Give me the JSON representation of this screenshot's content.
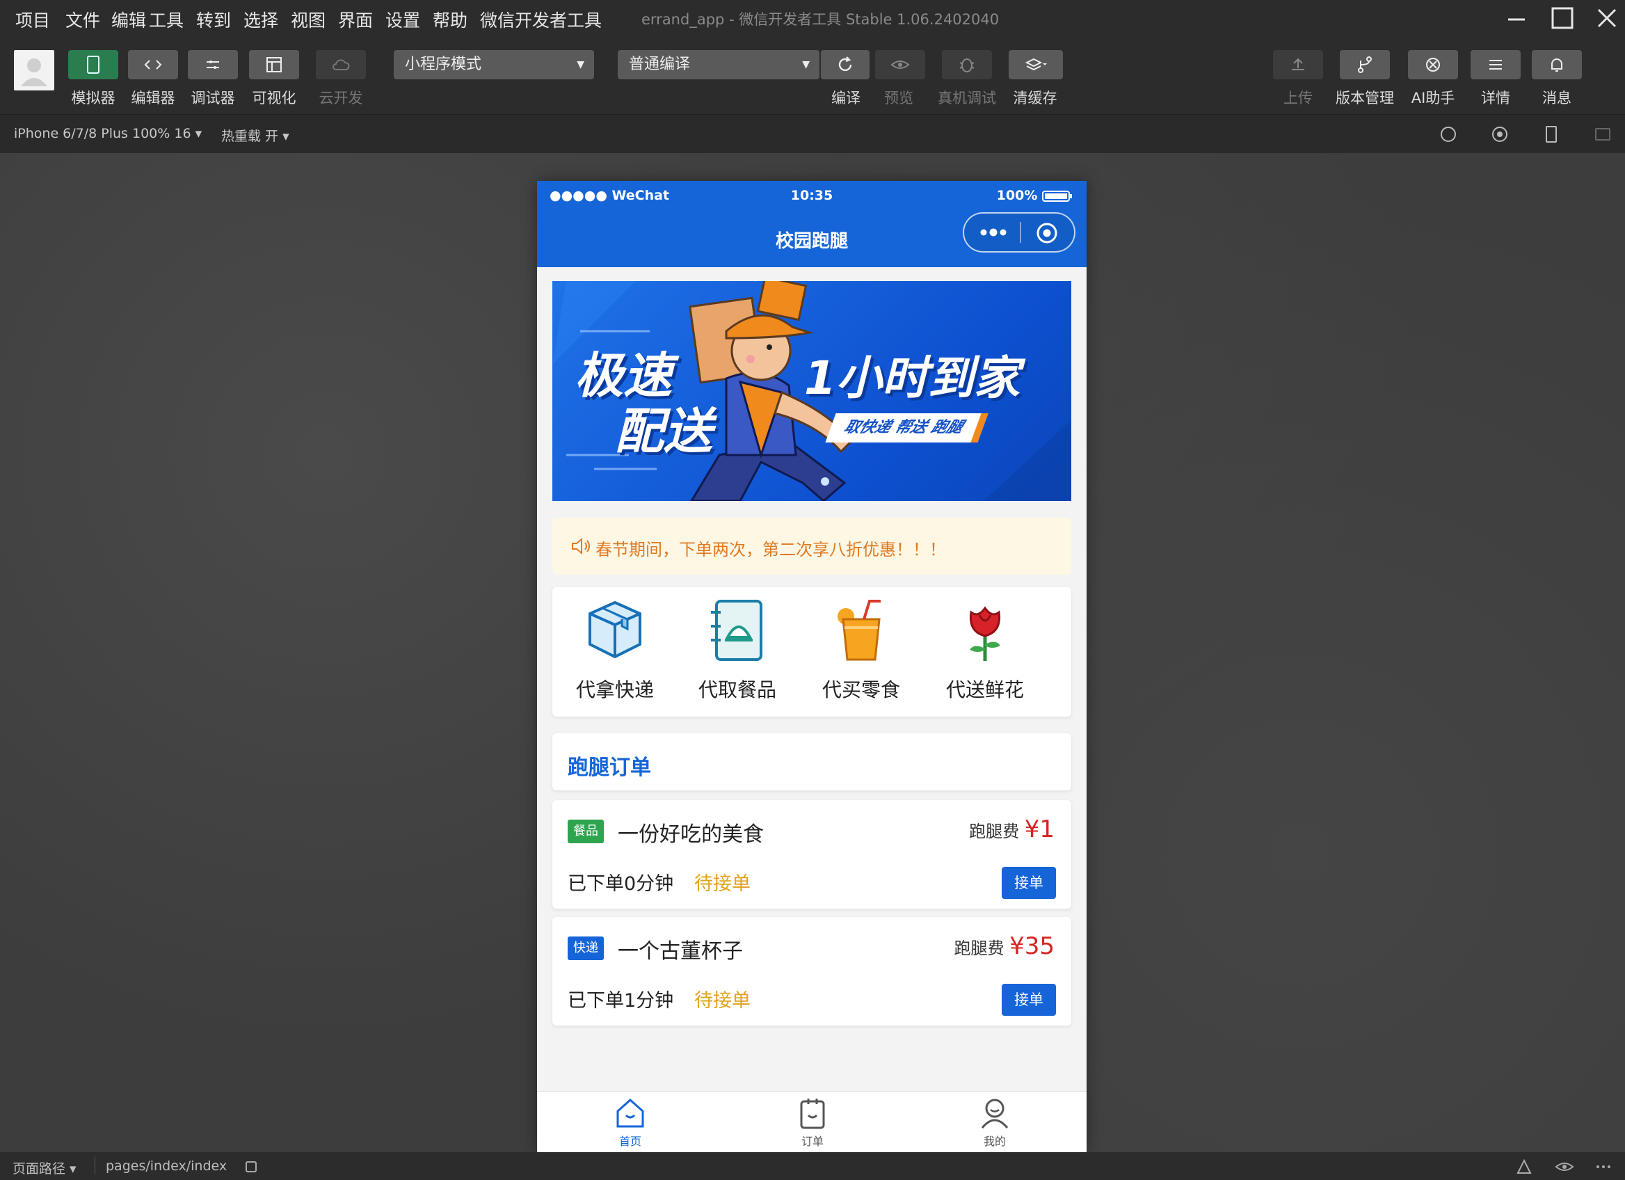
{
  "menubar": {
    "items": [
      "项目",
      "文件",
      "编辑",
      "工具",
      "转到",
      "选择",
      "视图",
      "界面",
      "设置",
      "帮助",
      "微信开发者工具"
    ],
    "window_title": "errand_app - 微信开发者工具 Stable 1.06.2402040"
  },
  "toolbar": {
    "buttons": [
      {
        "label": "模拟器",
        "icon": "phone-icon",
        "active": true
      },
      {
        "label": "编辑器",
        "icon": "code-icon",
        "active": false
      },
      {
        "label": "调试器",
        "icon": "debug-icon",
        "active": false
      },
      {
        "label": "可视化",
        "icon": "layout-icon",
        "active": false
      },
      {
        "label": "云开发",
        "icon": "cloud-icon",
        "active": false
      }
    ],
    "mode_select": "小程序模式",
    "compile_select": "普通编译",
    "compile_actions": [
      {
        "label": "编译",
        "icon": "refresh-icon"
      },
      {
        "label": "预览",
        "icon": "eye-icon"
      },
      {
        "label": "真机调试",
        "icon": "bug-icon"
      },
      {
        "label": "清缓存",
        "icon": "layers-icon"
      }
    ],
    "right_actions": [
      {
        "label": "上传",
        "icon": "upload-icon"
      },
      {
        "label": "版本管理",
        "icon": "branch-icon"
      },
      {
        "label": "AI助手",
        "icon": "ai-icon"
      },
      {
        "label": "详情",
        "icon": "menu-icon"
      },
      {
        "label": "消息",
        "icon": "bell-icon"
      }
    ]
  },
  "devicebar": {
    "device": "iPhone 6/7/8 Plus 100% 16",
    "compile_mode": "热重载 开"
  },
  "phone": {
    "status": {
      "signal": "●●●●● WeChat",
      "time": "10:35",
      "battery": "100%"
    },
    "title": "校园跑腿",
    "banner": {
      "line1": "极速",
      "line2": "配送",
      "headline": "1小时到家",
      "tag": "取快递 帮送 跑腿"
    },
    "notice": "春节期间，下单两次，第二次享八折优惠！！！",
    "services": [
      {
        "label": "代拿快递",
        "icon": "package-box-icon"
      },
      {
        "label": "代取餐品",
        "icon": "food-tray-icon"
      },
      {
        "label": "代买零食",
        "icon": "juice-cup-icon"
      },
      {
        "label": "代送鲜花",
        "icon": "rose-icon"
      }
    ],
    "orders_title": "跑腿订单",
    "fee_label": "跑腿费",
    "currency": "¥",
    "orders": [
      {
        "tag": "餐品",
        "tag_color": "#2ea44f",
        "title": "一份好吃的美食",
        "fee": "1",
        "time": "已下单0分钟",
        "status": "待接单",
        "button": "接单"
      },
      {
        "tag": "快递",
        "tag_color": "#1565d8",
        "title": "一个古董杯子",
        "fee": "35",
        "time": "已下单1分钟",
        "status": "待接单",
        "button": "接单"
      }
    ],
    "tabs": [
      {
        "label": "首页",
        "icon": "home-icon",
        "active": true
      },
      {
        "label": "订单",
        "icon": "order-clipboard-icon",
        "active": false
      },
      {
        "label": "我的",
        "icon": "profile-icon",
        "active": false
      }
    ]
  },
  "statusbar": {
    "path_select": "页面路径",
    "path": "pages/index/index"
  },
  "colors": {
    "accent": "#1565d8",
    "price": "#d82323",
    "pending": "#e0a21c"
  }
}
